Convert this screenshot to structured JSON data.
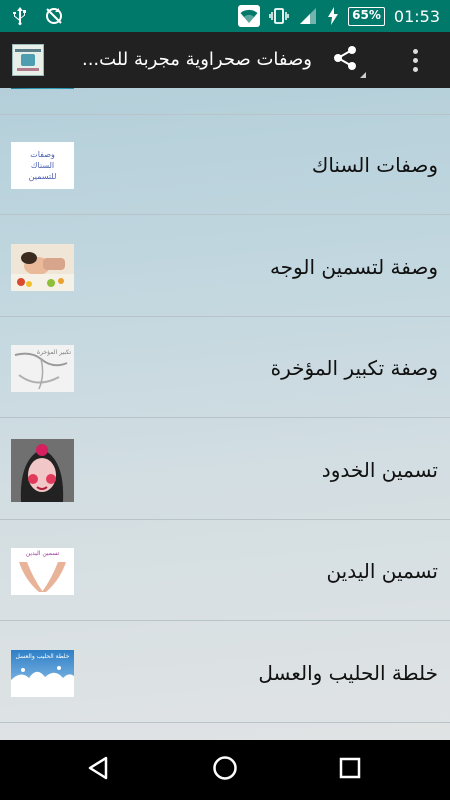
{
  "status_bar": {
    "time": "01:53",
    "battery": "65%",
    "icons": [
      "usb-icon",
      "sync-off-icon",
      "wifi-icon",
      "vibrate-icon",
      "signal-icon",
      "charging-icon"
    ]
  },
  "app_bar": {
    "title": "وصفات صحراوية مجربة للت...",
    "icons": [
      "app-logo",
      "share-icon",
      "overflow-menu-icon"
    ]
  },
  "list": {
    "items": [
      {
        "label": "",
        "thumb": "water-image"
      },
      {
        "label": "وصفات السناك",
        "thumb": "snack-text-card",
        "thumb_text": [
          "وصفات",
          "السناك",
          "للتسمين"
        ]
      },
      {
        "label": "وصفة لتسمين الوجه",
        "thumb": "face-spa-photo"
      },
      {
        "label": "وصفة تكبير المؤخرة",
        "thumb": "body-sketch",
        "thumb_text": [
          "تكبير المؤخرة"
        ]
      },
      {
        "label": "تسمين الخدود",
        "thumb": "cheeks-illustration"
      },
      {
        "label": "تسمين اليدين",
        "thumb": "hands-illustration",
        "thumb_text": [
          "تسمين اليدين"
        ]
      },
      {
        "label": "خلطة الحليب والعسل",
        "thumb": "milk-splash-image",
        "thumb_text": [
          "خلطة الحليب والعسل"
        ]
      }
    ]
  },
  "nav_bar": {
    "icons": [
      "back-icon",
      "home-icon",
      "recents-icon"
    ]
  },
  "colors": {
    "status_bar": "#00796b",
    "app_bar": "#212121",
    "nav_bar": "#000000",
    "list_text": "#111111"
  }
}
